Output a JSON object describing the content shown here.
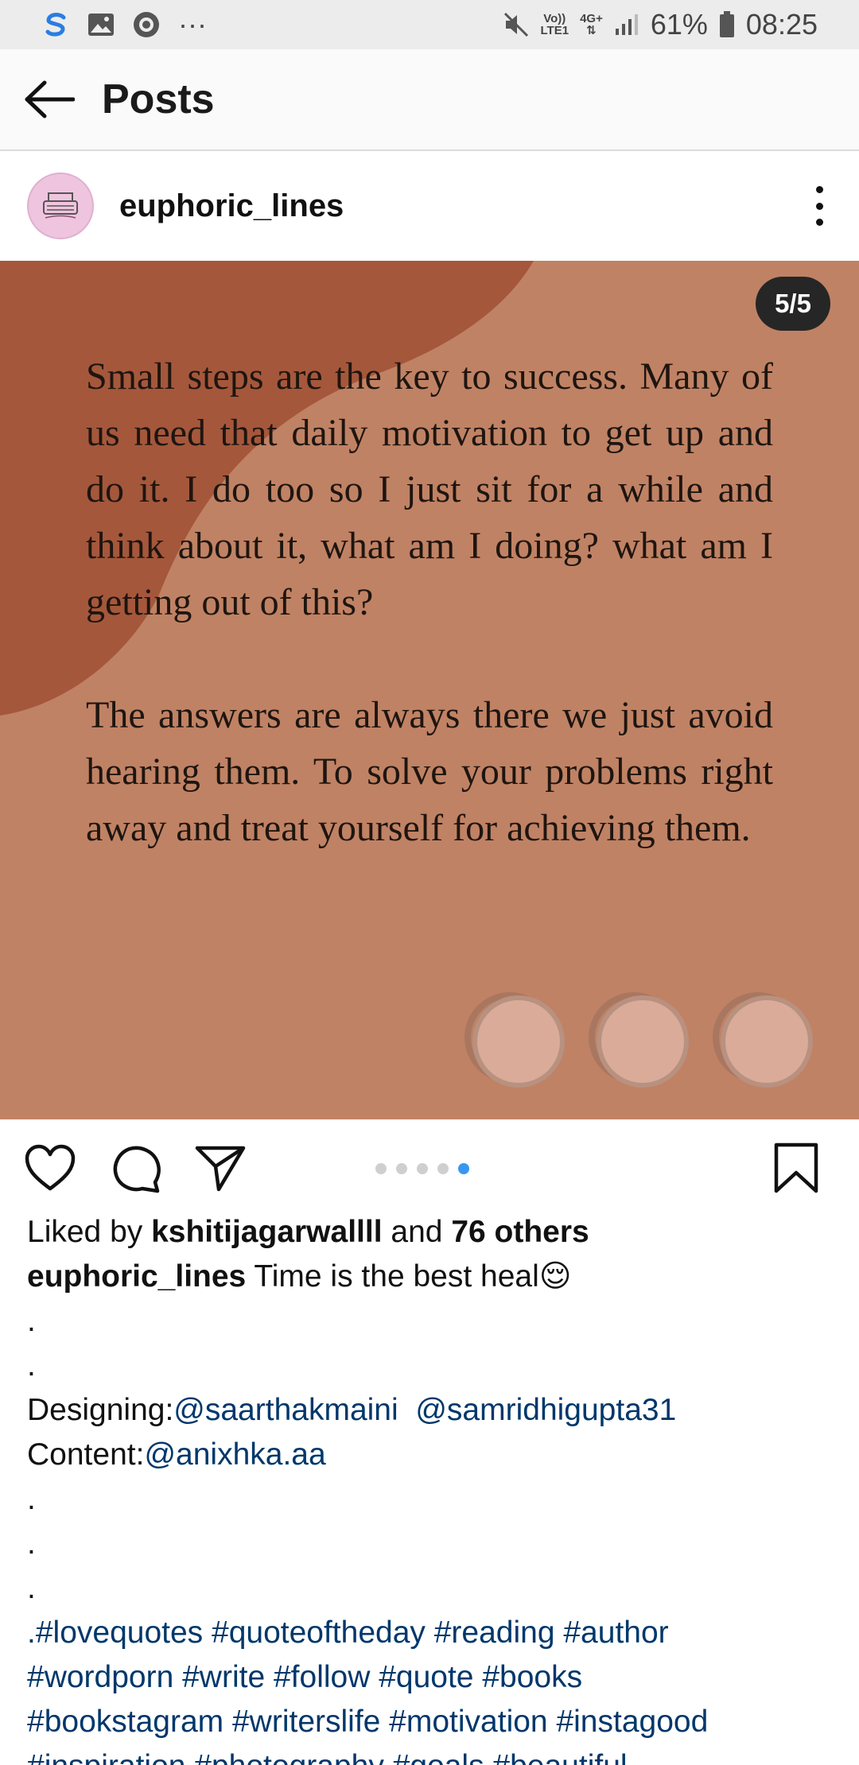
{
  "status_bar": {
    "battery": "61%",
    "time": "08:25",
    "network_volte": "Vo))",
    "network_lte": "LTE1",
    "network_4g": "4G+",
    "icons": [
      "sync-icon",
      "gallery-icon",
      "record-icon",
      "more-notifications-icon",
      "mute-icon",
      "signal-icon",
      "battery-icon"
    ]
  },
  "app_bar": {
    "title": "Posts"
  },
  "post": {
    "username": "euphoric_lines",
    "slide_counter": "5/5",
    "quote_paragraph_1": "Small steps are the key to success. Many of us need that daily motivation to get up and do it. I do too so I just sit for a while and think about it, what am I doing? what am I getting out of this?",
    "quote_paragraph_2": "The answers are always there we just avoid hearing them. To solve your problems right away and treat yourself for achieving them.",
    "slide_count": 5,
    "current_slide": 5,
    "colors": {
      "background": "#c08264",
      "blob": "#a5573b",
      "active_dot": "#3897f0"
    }
  },
  "likes": {
    "prefix": "Liked by ",
    "user": "kshitijagarwallll",
    "middle": " and ",
    "others": "76 others"
  },
  "caption": {
    "username": "euphoric_lines",
    "text": " Time is the best heal😌",
    "dot1": ".",
    "dot2": ".",
    "designing_label": "Designing:",
    "designing_mention_1": "@saarthakmaini",
    "designing_mention_2": "@samridhigupta31",
    "content_label": "Content:",
    "content_mention": "@anixhka.aa",
    "dot3": ".",
    "dot4": ".",
    "dot5": ".",
    "hashtags_line_1": ".#lovequotes #quoteoftheday #reading #author",
    "hashtags_line_2": "#wordporn #write #follow #quote #books",
    "hashtags_line_3": "#bookstagram #writerslife #motivation #instagood",
    "hashtags_line_4": "#inspiration #photography #goals #beautiful"
  }
}
